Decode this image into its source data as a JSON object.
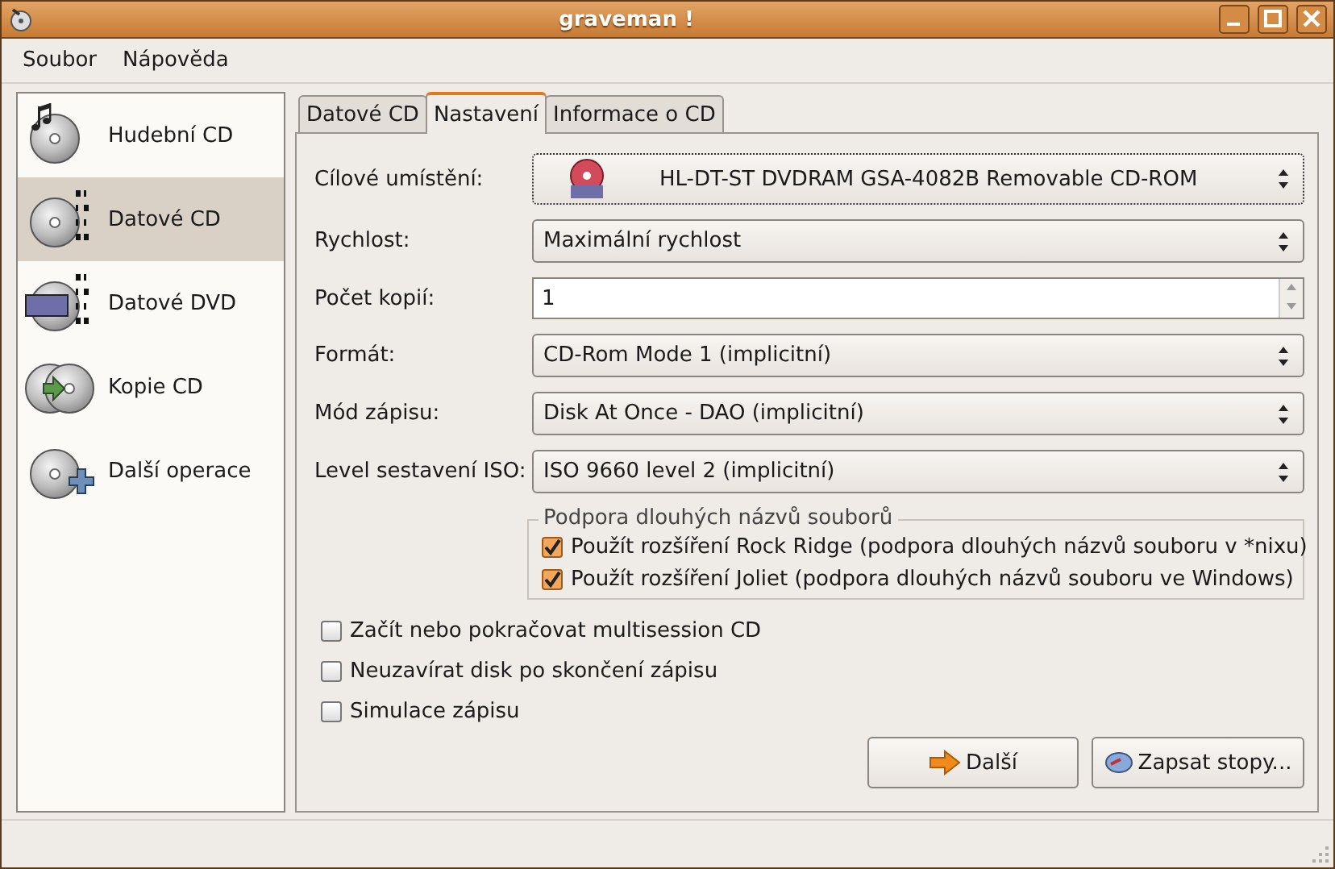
{
  "window": {
    "title": "graveman !"
  },
  "menu": [
    "Soubor",
    "Nápověda"
  ],
  "sidebar": {
    "items": [
      {
        "label": "Hudební CD",
        "kind": "audio",
        "selected": false
      },
      {
        "label": "Datové CD",
        "kind": "data_cd",
        "selected": true
      },
      {
        "label": "Datové DVD",
        "kind": "data_dvd",
        "selected": false
      },
      {
        "label": "Kopie CD",
        "kind": "copy",
        "selected": false
      },
      {
        "label": "Další operace",
        "kind": "other",
        "selected": false
      }
    ]
  },
  "tabs": [
    {
      "label": "Datové CD",
      "selected": false
    },
    {
      "label": "Nastavení",
      "selected": true
    },
    {
      "label": "Informace o CD",
      "selected": false
    }
  ],
  "fields": [
    {
      "label": "Cílové umístění:",
      "kind": "device",
      "value": "HL-DT-ST DVDRAM GSA-4082B Removable CD-ROM"
    },
    {
      "label": "Rychlost:",
      "kind": "combo",
      "value": "Maximální rychlost"
    },
    {
      "label": "Počet kopií:",
      "kind": "spin",
      "value": "1"
    },
    {
      "label": "Formát:",
      "kind": "combo",
      "value": "CD-Rom Mode 1 (implicitní)"
    },
    {
      "label": "Mód zápisu:",
      "kind": "combo",
      "value": "Disk At Once - DAO (implicitní)"
    },
    {
      "label": "Level sestavení ISO:",
      "kind": "combo",
      "value": "ISO 9660 level 2 (implicitní)"
    }
  ],
  "long_names": {
    "title": "Podpora dlouhých názvů souborů",
    "options": [
      {
        "label": "Použít rozšíření Rock Ridge (podpora dlouhých názvů souboru v *nixu)",
        "checked": true
      },
      {
        "label": "Použít rozšíření Joliet (podpora dlouhých názvů souboru ve Windows)",
        "checked": true
      }
    ]
  },
  "options": [
    {
      "label": "Začít nebo pokračovat multisession CD",
      "checked": false
    },
    {
      "label": "Neuzavírat disk po skončení zápisu",
      "checked": false
    },
    {
      "label": "Simulace zápisu",
      "checked": false
    }
  ],
  "buttons": [
    {
      "label": "Další",
      "kind": "next"
    },
    {
      "label": "Zapsat stopy...",
      "kind": "burn"
    }
  ]
}
